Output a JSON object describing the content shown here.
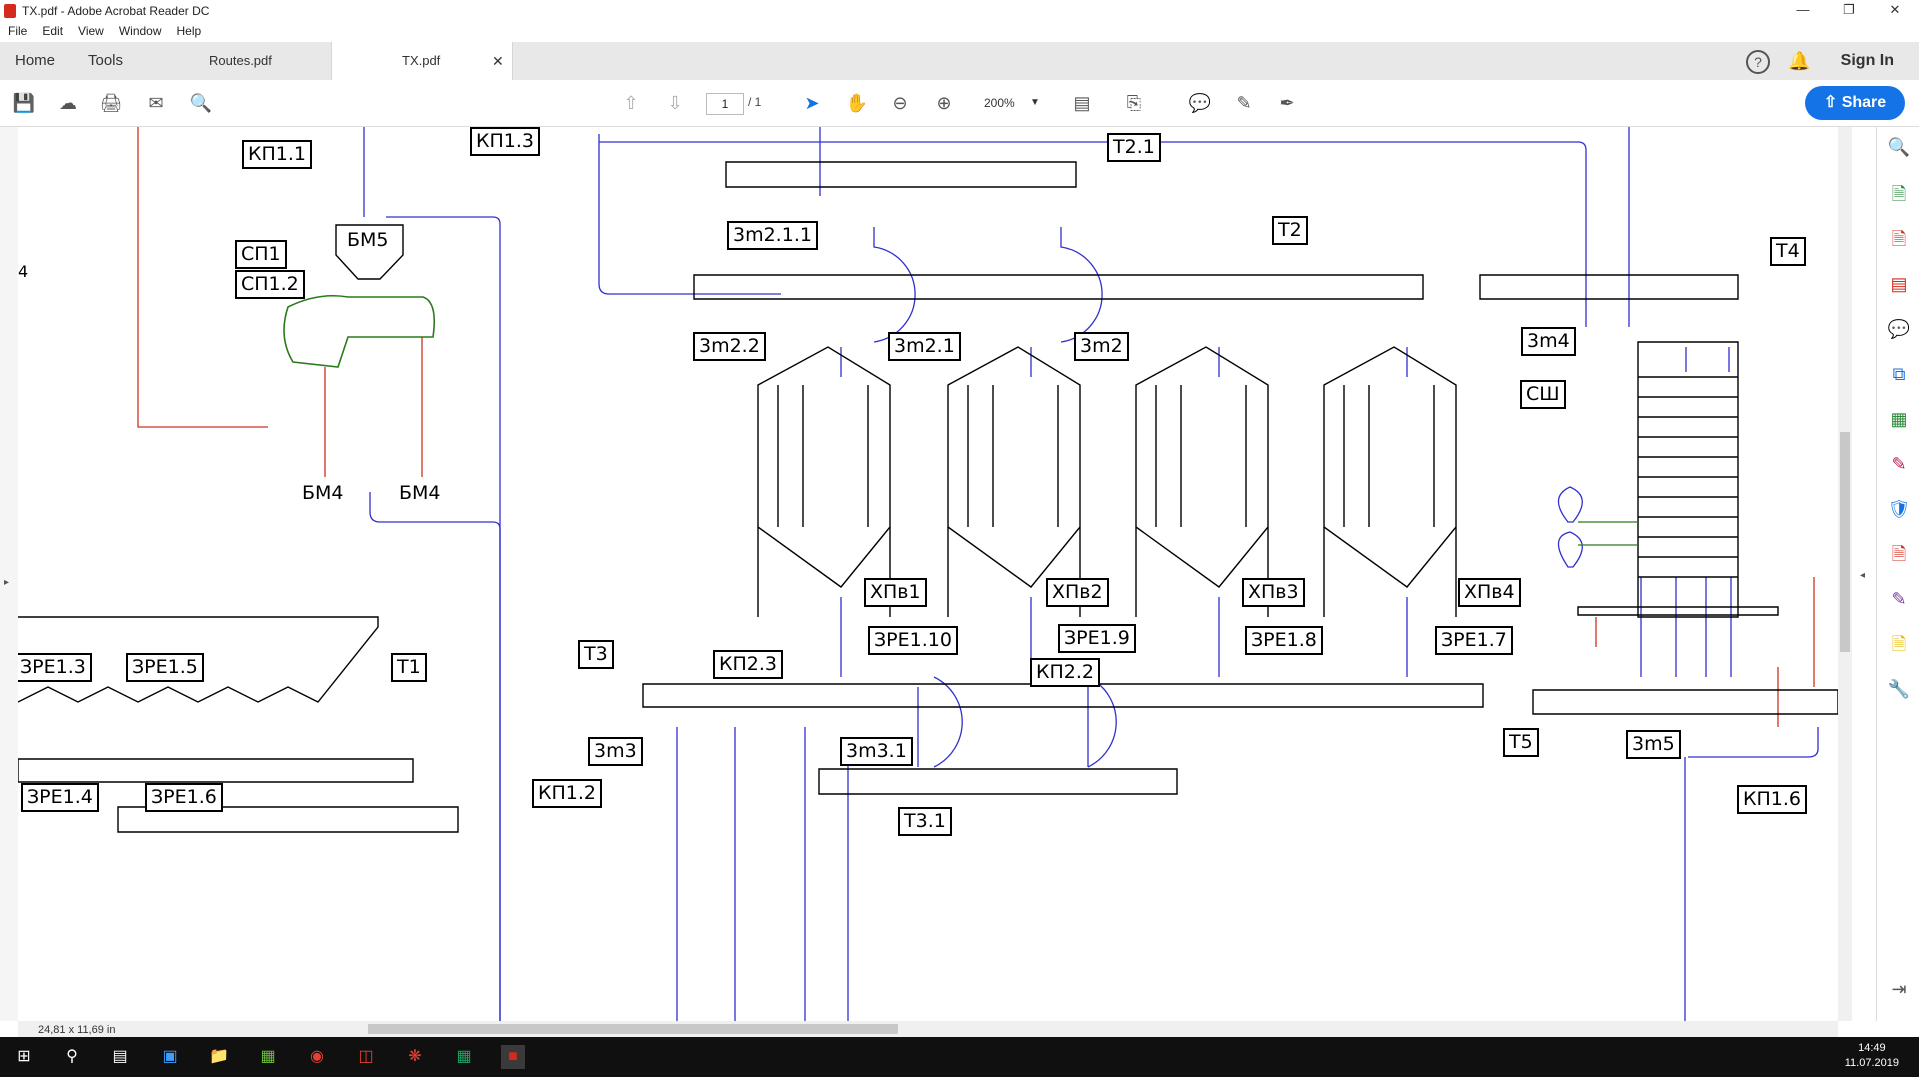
{
  "window": {
    "title": "TX.pdf - Adobe Acrobat Reader DC",
    "minimize": "—",
    "restore": "❐",
    "close": "✕"
  },
  "menu": [
    "File",
    "Edit",
    "View",
    "Window",
    "Help"
  ],
  "tabs": {
    "home": "Home",
    "tools": "Tools",
    "doc1": "Routes.pdf",
    "doc2": "TX.pdf",
    "close": "✕",
    "signin": "Sign In"
  },
  "toolbar": {
    "page": "1",
    "page_total": "/ 1",
    "zoom": "200%",
    "share": "Share"
  },
  "status": {
    "page_size": "24,81 x 11,69 in"
  },
  "clock": {
    "time": "14:49",
    "date": "11.07.2019"
  },
  "diagram": {
    "labels": {
      "kp11": "КП1.1",
      "kp13": "КП1.3",
      "bm5": "БМ5",
      "sp1": "СП1",
      "sp12": "СП1.2",
      "t21": "Т2.1",
      "zm211": "3m2.1.1",
      "t2": "Т2",
      "t4": "Т4",
      "zm22": "3m2.2",
      "zm21": "3m2.1",
      "zm2": "3m2",
      "zm4": "3m4",
      "ssh": "СШ",
      "bm4a": "БМ4",
      "bm4b": "БМ4",
      "hpv1": "ХПв1",
      "hpv2": "ХПв2",
      "hpv3": "ХПв3",
      "hpv4": "ХПв4",
      "zre110": "ЗРЕ1.10",
      "zre19": "ЗРЕ1.9",
      "zre18": "ЗРЕ1.8",
      "zre17": "ЗРЕ1.7",
      "t3": "Т3",
      "kp23": "КП2.3",
      "kp22": "КП2.2",
      "zre13": "ЗРЕ1.3",
      "zre15": "ЗРЕ1.5",
      "t1": "Т1",
      "zm3": "3m3",
      "zm31": "3m3.1",
      "t5": "Т5",
      "zm5": "3m5",
      "zre14": "ЗРЕ1.4",
      "zre16": "ЗРЕ1.6",
      "kp12": "КП1.2",
      "t31": "Т3.1",
      "kp16": "КП1.6",
      "edge4": "4"
    }
  }
}
